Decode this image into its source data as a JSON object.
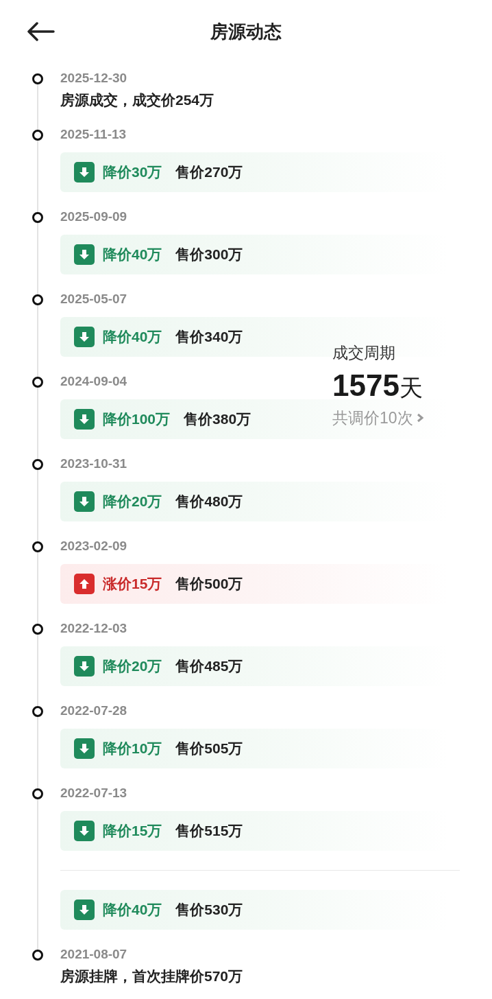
{
  "header": {
    "title": "房源动态"
  },
  "summary": {
    "label": "成交周期",
    "days": "1575",
    "unit": "天",
    "adjustments": "共调价10次"
  },
  "events": [
    {
      "kind": "text",
      "date": "2025-12-30",
      "text": "房源成交，成交价254万"
    },
    {
      "kind": "decrease",
      "date": "2025-11-13",
      "change": "降价30万",
      "price": "售价270万"
    },
    {
      "kind": "decrease",
      "date": "2025-09-09",
      "change": "降价40万",
      "price": "售价300万"
    },
    {
      "kind": "decrease",
      "date": "2025-05-07",
      "change": "降价40万",
      "price": "售价340万"
    },
    {
      "kind": "decrease",
      "date": "2024-09-04",
      "change": "降价100万",
      "price": "售价380万"
    },
    {
      "kind": "decrease",
      "date": "2023-10-31",
      "change": "降价20万",
      "price": "售价480万"
    },
    {
      "kind": "increase",
      "date": "2023-02-09",
      "change": "涨价15万",
      "price": "售价500万"
    },
    {
      "kind": "decrease",
      "date": "2022-12-03",
      "change": "降价20万",
      "price": "售价485万"
    },
    {
      "kind": "decrease",
      "date": "2022-07-28",
      "change": "降价10万",
      "price": "售价505万"
    },
    {
      "kind": "decrease",
      "date": "2022-07-13",
      "change": "降价15万",
      "price": "售价515万"
    },
    {
      "kind": "decrease",
      "change": "降价40万",
      "price": "售价530万"
    },
    {
      "kind": "text",
      "date": "2021-08-07",
      "text": "房源挂牌，首次挂牌价570万"
    }
  ]
}
